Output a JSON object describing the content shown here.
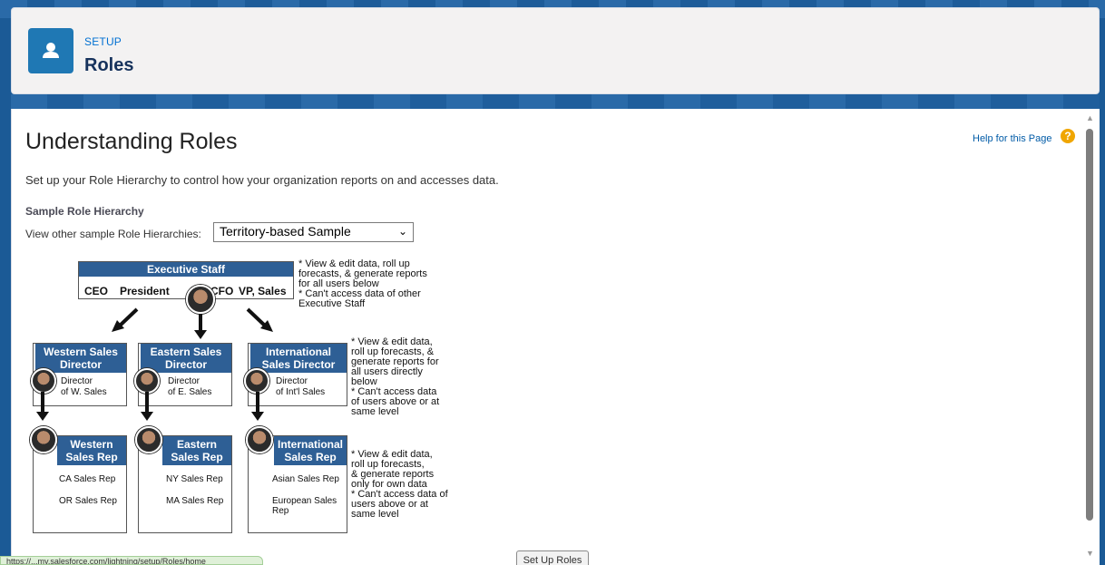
{
  "header": {
    "eyebrow": "SETUP",
    "title": "Roles",
    "icon": "user-icon"
  },
  "page": {
    "title": "Understanding Roles",
    "help_link": "Help for this Page",
    "intro": "Set up your Role Hierarchy to control how your organization reports on and accesses data.",
    "sample_heading": "Sample Role Hierarchy",
    "select_label": "View other sample Role Hierarchies:",
    "select_value": "Territory-based Sample"
  },
  "diagram": {
    "exec": {
      "title": "Executive Staff",
      "roles": [
        "CEO",
        "President",
        "CFO",
        "VP, Sales"
      ],
      "note": [
        "* View & edit data, roll up",
        "forecasts, & generate reports",
        "for all users below",
        "* Can't access data of other",
        "Executive Staff"
      ]
    },
    "directors": [
      {
        "title1": "Western Sales",
        "title2": "Director",
        "desc1": "Director",
        "desc2": "of W. Sales"
      },
      {
        "title1": "Eastern Sales",
        "title2": "Director",
        "desc1": "Director",
        "desc2": "of E. Sales"
      },
      {
        "title1": "International",
        "title2": "Sales Director",
        "desc1": "Director",
        "desc2": "of Int'l Sales"
      }
    ],
    "director_note": [
      "* View & edit data,",
      "roll up forecasts, &",
      "generate reports for",
      "all users directly",
      "below",
      "* Can't access data",
      "of users above or at",
      "same level"
    ],
    "reps": [
      {
        "title1": "Western",
        "title2": "Sales Rep",
        "items": [
          "CA Sales Rep",
          "OR Sales Rep"
        ]
      },
      {
        "title1": "Eastern",
        "title2": "Sales Rep",
        "items": [
          "NY Sales Rep",
          "MA Sales Rep"
        ]
      },
      {
        "title1": "International",
        "title2": "Sales Rep",
        "items": [
          "Asian Sales Rep",
          "European Sales Rep"
        ]
      }
    ],
    "rep_note": [
      "* View & edit data,",
      "roll up forecasts,",
      "& generate reports",
      "only for own data",
      "* Can't access data of",
      "users above or at",
      "same level"
    ]
  },
  "button": {
    "setup_roles": "Set Up Roles"
  },
  "status": "https://...my.salesforce.com/lightning/setup/Roles/home"
}
